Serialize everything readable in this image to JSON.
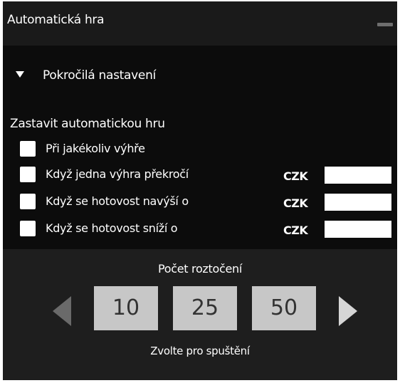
{
  "window": {
    "title": "Automatická hra"
  },
  "advanced": {
    "label": "Pokročilá nastavení"
  },
  "stop": {
    "label": "Zastavit automatickou hru",
    "options": [
      {
        "label": "Při jakékoliv výhře"
      },
      {
        "label": "Když jedna výhra překročí",
        "currency": "CZK",
        "value": ""
      },
      {
        "label": "Když se hotovost navýší o",
        "currency": "CZK",
        "value": ""
      },
      {
        "label": "Když se hotovost sníží o",
        "currency": "CZK",
        "value": ""
      }
    ]
  },
  "spins": {
    "label": "Počet roztočení",
    "options": [
      "10",
      "25",
      "50"
    ],
    "hint": "Zvolte pro spuštění"
  },
  "colors": {
    "panel_bg": "#0c0c0c",
    "titlebar_bg": "#1a1a1a",
    "bottom_bg": "#1e1e1e",
    "spin_button_bg": "#c7c7c7",
    "text": "#ffffff"
  },
  "icons": {
    "minimize": "minimize-icon",
    "expand": "triangle-down-icon",
    "prev": "arrow-left-icon",
    "next": "arrow-right-icon"
  }
}
